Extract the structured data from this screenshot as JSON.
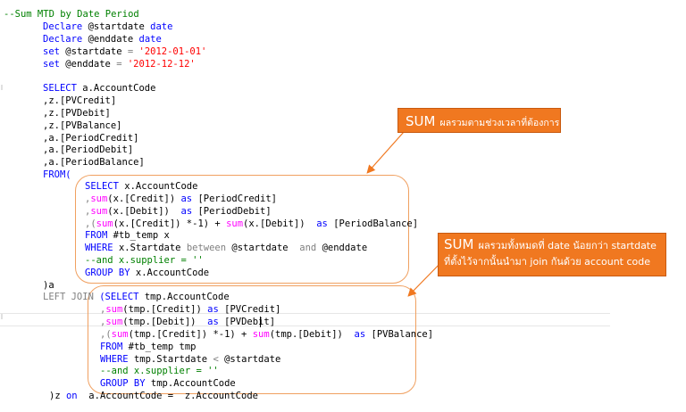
{
  "code": {
    "line1": "--Sum MTD by Date Period",
    "declare1_kw": "Declare",
    "declare1_var": "@startdate",
    "declare1_type": "date",
    "declare2_kw": "Declare",
    "declare2_var": "@enddate",
    "declare2_type": "date",
    "set1_kw": "set",
    "set1_var": "@startdate",
    "set1_eq": "=",
    "set1_val": "'2012-01-01'",
    "set2_kw": "set",
    "set2_var": "@enddate",
    "set2_eq": "=",
    "set2_val": "'2012-12-12'",
    "select1_kw": "SELECT",
    "select1_col": "a.AccountCode",
    "col_pvcredit": ",z.[PVCredit]",
    "col_pvdebit": ",z.[PVDebit]",
    "col_pvbalance": ",z.[PVBalance]",
    "col_periodcredit": ",a.[PeriodCredit]",
    "col_perioddebit": ",a.[PeriodDebit]",
    "col_periodbalance": ",a.[PeriodBalance]",
    "from_kw": "FROM(",
    "sub1_select_kw": "SELECT",
    "sub1_select_col": "x.AccountCode",
    "sub1_l2_comma": ",",
    "sub1_l2_fn": "sum",
    "sub1_l2_rest": "(x.[Credit])",
    "sub1_l2_as": "as",
    "sub1_l2_alias": "[PeriodCredit]",
    "sub1_l3_comma": ",",
    "sub1_l3_fn": "sum",
    "sub1_l3_rest": "(x.[Debit])",
    "sub1_l3_as": "as",
    "sub1_l3_alias": "[PeriodDebit]",
    "sub1_l4_a": ",(",
    "sub1_l4_fn1": "sum",
    "sub1_l4_b": "(x.[Credit]) *-1) +",
    "sub1_l4_fn2": "sum",
    "sub1_l4_c": "(x.[Debit])",
    "sub1_l4_as": "as",
    "sub1_l4_alias": "[PeriodBalance]",
    "sub1_from_kw": "FROM",
    "sub1_from_rest": "#tb_temp x",
    "sub1_where_kw": "WHERE",
    "sub1_where_a": "x.Startdate",
    "sub1_where_between": "between",
    "sub1_where_b": "@startdate",
    "sub1_where_and": "and",
    "sub1_where_c": "@enddate",
    "sub1_comment": "--and x.supplier = ''",
    "sub1_group_kw": "GROUP BY",
    "sub1_group_rest": "x.AccountCode",
    "alias_a": ")a",
    "left_join_kw": "LEFT JOIN",
    "sub2_select_kw": "(SELECT",
    "sub2_select_col": "tmp.AccountCode",
    "sub2_l2_comma": ",",
    "sub2_l2_fn": "sum",
    "sub2_l2_rest": "(tmp.[Credit])",
    "sub2_l2_as": "as",
    "sub2_l2_alias": "[PVCredit]",
    "sub2_l3_comma": ",",
    "sub2_l3_fn": "sum",
    "sub2_l3_rest": "(tmp.[Debit])",
    "sub2_l3_as": "as",
    "sub2_l3_alias": "[PVDebit]",
    "sub2_l4_a": ",(",
    "sub2_l4_fn1": "sum",
    "sub2_l4_b": "(tmp.[Credit]) *-1) +",
    "sub2_l4_fn2": "sum",
    "sub2_l4_c": "(tmp.[Debit])",
    "sub2_l4_as": "as",
    "sub2_l4_alias": "[PVBalance]",
    "sub2_from_kw": "FROM",
    "sub2_from_rest": "#tb_temp tmp",
    "sub2_where_kw": "WHERE",
    "sub2_where_a": "tmp.Startdate",
    "sub2_where_lt": "<",
    "sub2_where_b": "@startdate",
    "sub2_comment": "--and x.supplier = ''",
    "sub2_group_kw": "GROUP BY",
    "sub2_group_rest": "tmp.AccountCode",
    "last_a": ")z",
    "last_on": "on",
    "last_b": "a.AccountCode =",
    "last_c": "z.AccountCode"
  },
  "callouts": {
    "mtd": {
      "lead": "SUM",
      "rest": "ผลรวมตามช่วงเวลาที่ต้องการ"
    },
    "pv": {
      "line1_lead": "SUM",
      "line1_rest": "ผลรวมทั้งหมดที่ date น้อยกว่า startdate",
      "line2": "ที่ตั้งไว้จากนั้นนำมา join กันด้วย account code"
    }
  },
  "colors": {
    "keyword": "#0000ff",
    "function": "#ff00ff",
    "string": "#ff0000",
    "comment": "#008000",
    "callout_fill": "#f07820",
    "box_outline": "#f0a060"
  }
}
